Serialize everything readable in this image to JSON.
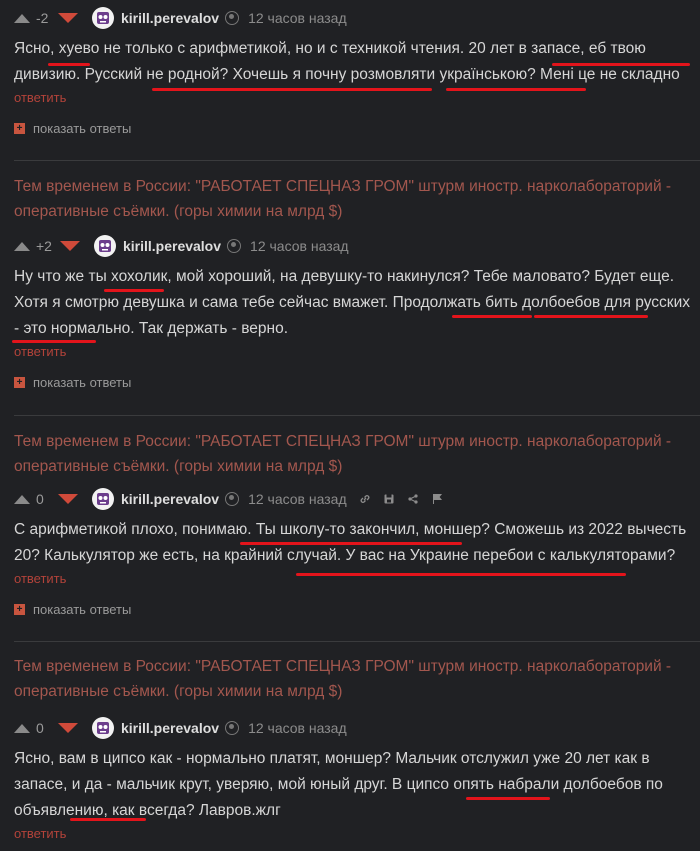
{
  "comments": [
    {
      "rating": "-2",
      "author": "kirill.perevalov",
      "time": "12 часов назад",
      "text": "Ясно, хуево не только с арифметикой, но и с техникой чтения. 20 лет в запасе, еб твою дивизию. Русский не родной? Хочешь я почну розмовляти українською? Мені це не складно",
      "reply": "ответить",
      "show_replies": "показать ответы"
    },
    {
      "rating": "+2",
      "author": "kirill.perevalov",
      "time": "12 часов назад",
      "text": "Ну что же ты хохолик, мой хороший, на девушку-то накинулся? Тебе маловато? Будет еще. Хотя я смотрю девушка и сама тебе сейчас вмажет. Продолжать бить долбоебов для русских - это нормально. Так держать - верно.",
      "reply": "ответить",
      "show_replies": "показать ответы"
    },
    {
      "rating": "0",
      "author": "kirill.perevalov",
      "time": "12 часов назад",
      "text": "С арифметикой плохо, понимаю. Ты школу-то закончил, моншер? Сможешь из 2022 вычесть 20? Калькулятор же есть, на крайний случай. У вас на Украине перебои с калькуляторами?",
      "reply": "ответить",
      "show_replies": "показать ответы"
    },
    {
      "rating": "0",
      "author": "kirill.perevalov",
      "time": "12 часов назад",
      "text": "Ясно, вам в ципсо как - нормально платят, моншер? Мальчик отслужил уже 20 лет как в запасе, и да - мальчик крут, уверяю, мой юный друг. В ципсо опять набрали долбоебов по объявлению, как всегда? Лавров.жлг",
      "reply": "ответить"
    }
  ],
  "post_title": "Тем временем в России: \"РАБОТАЕТ СПЕЦНАЗ ГРОМ\" штурм иностр. нарколабораторий - оперативные съёмки. (горы химии на млрд $)",
  "icons": {
    "vote_up": "arrow-up-icon",
    "vote_down": "arrow-down-icon",
    "user": "user-icon",
    "link": "link-icon",
    "save": "save-icon",
    "share": "share-icon",
    "report": "flag-icon",
    "expand": "plus-icon"
  },
  "colors": {
    "background": "#202124",
    "accent": "#d04a3a",
    "post_title": "#a3574e",
    "underline": "#e3141b"
  }
}
